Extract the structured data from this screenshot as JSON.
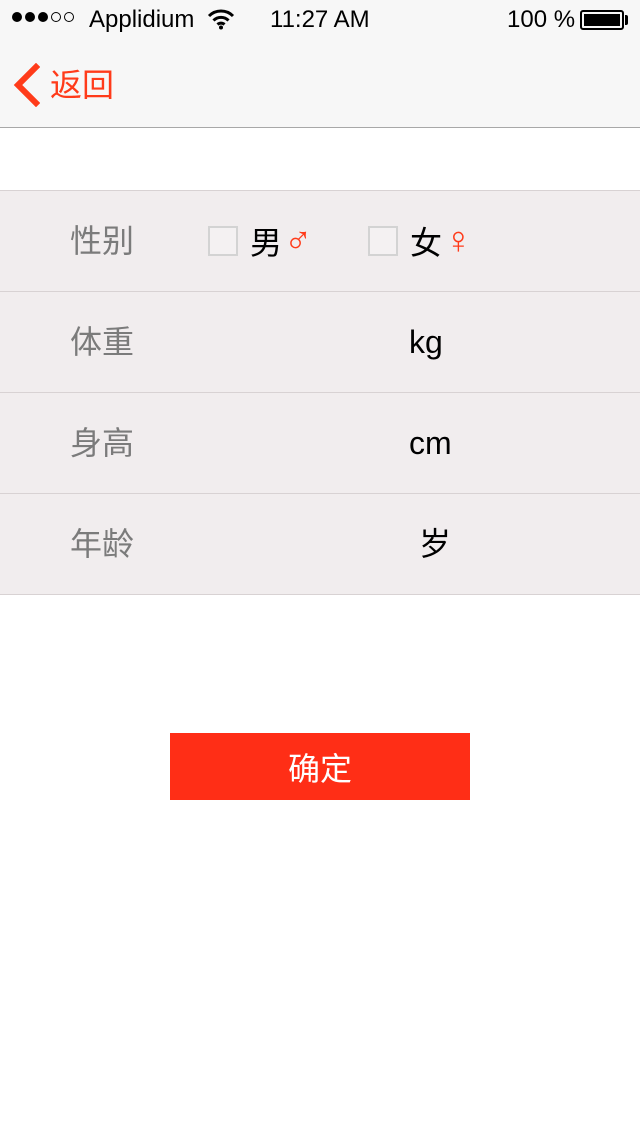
{
  "status_bar": {
    "carrier": "Applidium",
    "time": "11:27 AM",
    "battery": "100 %",
    "signal_bars_filled": 3,
    "signal_bars_total": 5
  },
  "nav": {
    "back_label": "返回"
  },
  "form": {
    "gender": {
      "label": "性别",
      "male_label": "男",
      "male_symbol": "♂",
      "female_label": "女",
      "female_symbol": "♀"
    },
    "weight": {
      "label": "体重",
      "value": "",
      "unit": "kg"
    },
    "height": {
      "label": "身高",
      "value": "",
      "unit": "cm"
    },
    "age": {
      "label": "年龄",
      "value": "",
      "unit": "岁"
    }
  },
  "confirm_label": "确定",
  "colors": {
    "accent": "#ff3b1a",
    "button": "#ff2e16",
    "form_background": "#f1edee"
  }
}
